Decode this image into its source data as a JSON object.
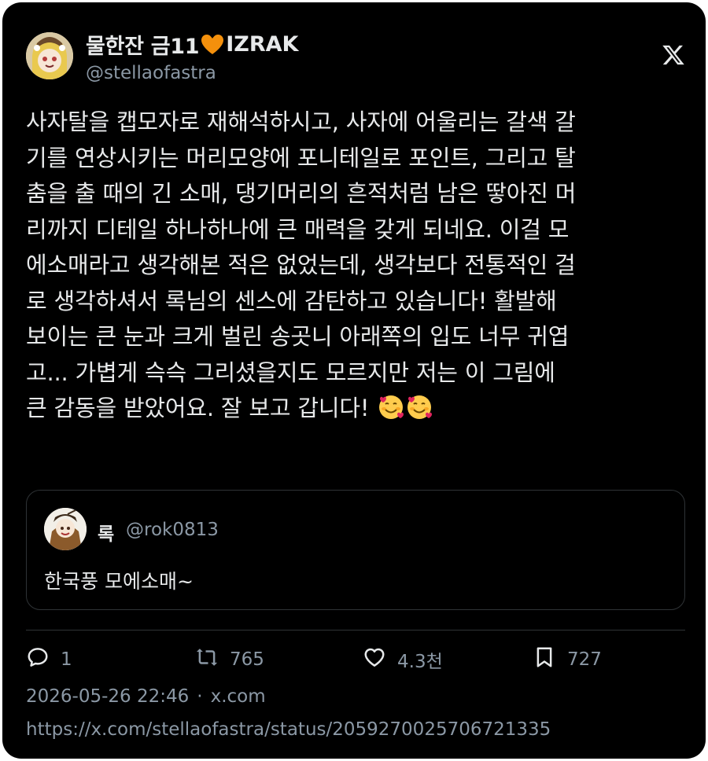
{
  "author": {
    "display_name": "물한잔 금11",
    "name_suffix": "IZRAK",
    "handle": "@stellaofastra"
  },
  "tweet": {
    "lines": [
      "사자탈을 캡모자로 재해석하시고, 사자에 어울리는 갈색 갈",
      "기를 연상시키는 머리모양에 포니테일로 포인트, 그리고 탈",
      "춤을 출 때의 긴 소매, 댕기머리의 흔적처럼 남은 땋아진 머",
      "리까지 디테일 하나하나에 큰 매력을 갖게 되네요. 이걸 모",
      "에소매라고 생각해본 적은 없었는데, 생각보다 전통적인 걸",
      "로 생각하셔서 록님의 센스에 감탄하고 있습니다! 활발해",
      "보이는 큰 눈과 크게 벌린 송곳니 아래쪽의 입도 너무 귀엽",
      "고... 가볍게 슥슥 그리셨을지도 모르지만 저는 이 그림에",
      "큰 감동을 받았어요. 잘 보고 갑니다!"
    ],
    "emojis": [
      "smiling-face-with-hearts",
      "smiling-face-with-hearts"
    ]
  },
  "quote": {
    "name": "록",
    "handle": "@rok0813",
    "text": "한국풍 모에소매~"
  },
  "actions": {
    "replies": "1",
    "retweets": "765",
    "likes": "4.3천",
    "bookmarks": "727"
  },
  "meta": {
    "timestamp": "2026-05-26 22:46",
    "separator": "·",
    "source": "x.com",
    "url": "https://x.com/stellaofastra/status/2059270025706721335"
  },
  "colors": {
    "background": "#000000",
    "text": "#e7e9ea",
    "secondary": "#8b98a5",
    "border": "#2f3336",
    "heart": "#f4900c"
  }
}
